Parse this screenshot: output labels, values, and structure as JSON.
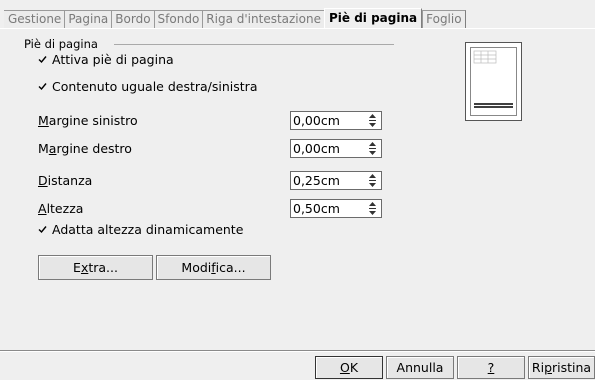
{
  "tabs": [
    {
      "label": "Gestione",
      "active": false
    },
    {
      "label": "Pagina",
      "active": false
    },
    {
      "label": "Bordo",
      "active": false
    },
    {
      "label": "Sfondo",
      "active": false
    },
    {
      "label": "Riga d'intestazione",
      "active": false
    },
    {
      "label": "Piè di pagina",
      "active": true
    },
    {
      "label": "Foglio",
      "active": false
    }
  ],
  "group": {
    "title": "Piè di pagina"
  },
  "checkboxes": {
    "enable_footer": {
      "label": "Attiva piè di pagina",
      "checked": true
    },
    "same_content": {
      "label": "Contenuto uguale destra/sinistra",
      "checked": true
    },
    "autofit_height": {
      "label": "Adatta altezza dinamicamente",
      "checked": true
    }
  },
  "fields": {
    "left_margin": {
      "label_u": "M",
      "label_rest": "argine sinistro",
      "value": "0,00cm"
    },
    "right_margin": {
      "label_pre": "M",
      "label_u": "a",
      "label_rest": "rgine destro",
      "value": "0,00cm"
    },
    "spacing": {
      "label_u": "D",
      "label_rest": "istanza",
      "value": "0,25cm"
    },
    "height": {
      "label_u": "A",
      "label_rest": "ltezza",
      "value": "0,50cm"
    }
  },
  "buttons": {
    "extra": {
      "pre": "E",
      "u": "x",
      "rest": "tra..."
    },
    "edit": {
      "pre": "Modi",
      "u": "f",
      "rest": "ica..."
    },
    "ok": {
      "pre": "",
      "u": "O",
      "rest": "K"
    },
    "cancel": "Annulla",
    "help": {
      "u": "?"
    },
    "reset": {
      "pre": "Ri",
      "u": "p",
      "rest": "ristina"
    }
  },
  "icons": {
    "checkbox": "checkmark-icon",
    "spin": "spin-arrows-icon",
    "preview": "page-preview-icon"
  }
}
